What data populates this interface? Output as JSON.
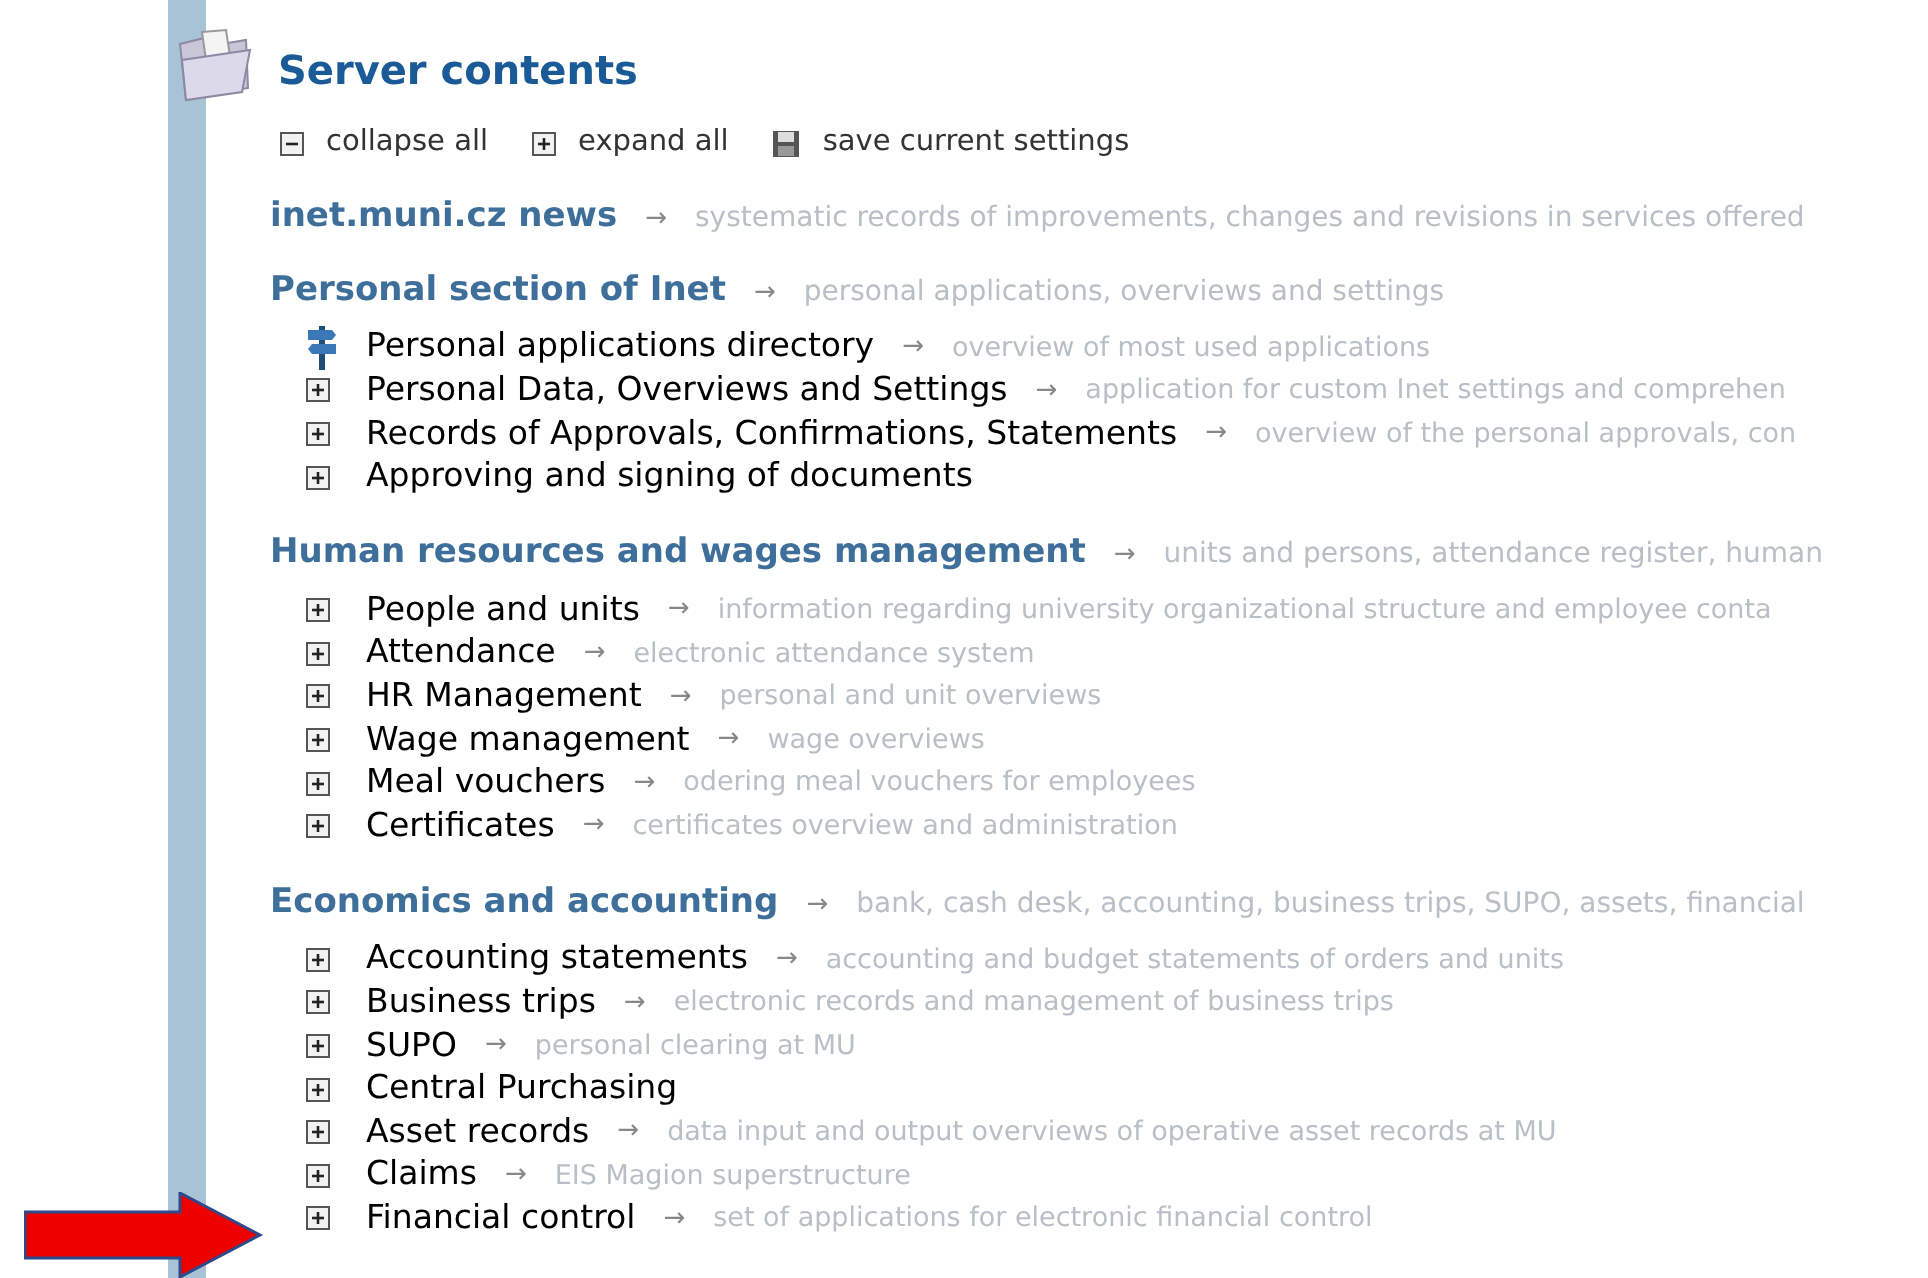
{
  "title": "Server contents",
  "toolbar": [
    {
      "kind": "collapse",
      "label": "collapse all"
    },
    {
      "kind": "expand",
      "label": "expand all"
    },
    {
      "kind": "save",
      "label": "save current settings"
    }
  ],
  "sections": [
    {
      "heading": "inet.muni.cz news",
      "arrow": "→",
      "description": "systematic records of improvements, changes and revisions in services offered"
    },
    {
      "heading": "Personal section of Inet",
      "arrow": "→",
      "description": "personal applications, overviews and settings",
      "items": [
        {
          "kind": "signpost",
          "label": "Personal applications directory",
          "arrow": "→",
          "description": "overview of most used applications"
        },
        {
          "kind": "expand",
          "label": "Personal Data, Overviews and Settings",
          "arrow": "→",
          "description": "application for custom Inet settings and comprehen"
        },
        {
          "kind": "expand",
          "label": "Records of Approvals, Confirmations, Statements",
          "arrow": "→",
          "description": "overview of the personal approvals, con"
        },
        {
          "kind": "expand",
          "label": "Approving and signing of documents"
        }
      ]
    },
    {
      "heading": "Human resources and wages management",
      "arrow": "→",
      "description": "units and persons, attendance register, human",
      "items": [
        {
          "kind": "expand",
          "label": "People and units",
          "arrow": "→",
          "description": "information regarding university organizational structure and employee conta"
        },
        {
          "kind": "expand",
          "label": "Attendance",
          "arrow": "→",
          "description": "electronic attendance system"
        },
        {
          "kind": "expand",
          "label": "HR Management",
          "arrow": "→",
          "description": "personal and unit overviews"
        },
        {
          "kind": "expand",
          "label": "Wage management",
          "arrow": "→",
          "description": "wage overviews"
        },
        {
          "kind": "expand",
          "label": "Meal vouchers",
          "arrow": "→",
          "description": "odering meal vouchers for employees"
        },
        {
          "kind": "expand",
          "label": "Certificates",
          "arrow": "→",
          "description": "certificates overview and administration"
        }
      ]
    },
    {
      "heading": "Economics and accounting",
      "arrow": "→",
      "description": "bank, cash desk, accounting, business trips, SUPO, assets, financial",
      "items": [
        {
          "kind": "expand",
          "label": "Accounting statements",
          "arrow": "→",
          "description": "accounting and budget statements of orders and units"
        },
        {
          "kind": "expand",
          "label": "Business trips",
          "arrow": "→",
          "description": "electronic records and management of business trips"
        },
        {
          "kind": "expand",
          "label": "SUPO",
          "arrow": "→",
          "description": "personal clearing at MU"
        },
        {
          "kind": "expand",
          "label": "Central Purchasing"
        },
        {
          "kind": "expand",
          "label": "Asset records",
          "arrow": "→",
          "description": "data input and output overviews of operative asset records at MU"
        },
        {
          "kind": "expand",
          "label": "Claims",
          "arrow": "→",
          "description": "EIS Magion superstructure"
        },
        {
          "kind": "expand",
          "label": "Financial control",
          "arrow": "→",
          "description": "set of applications for electronic financial control"
        }
      ]
    }
  ]
}
